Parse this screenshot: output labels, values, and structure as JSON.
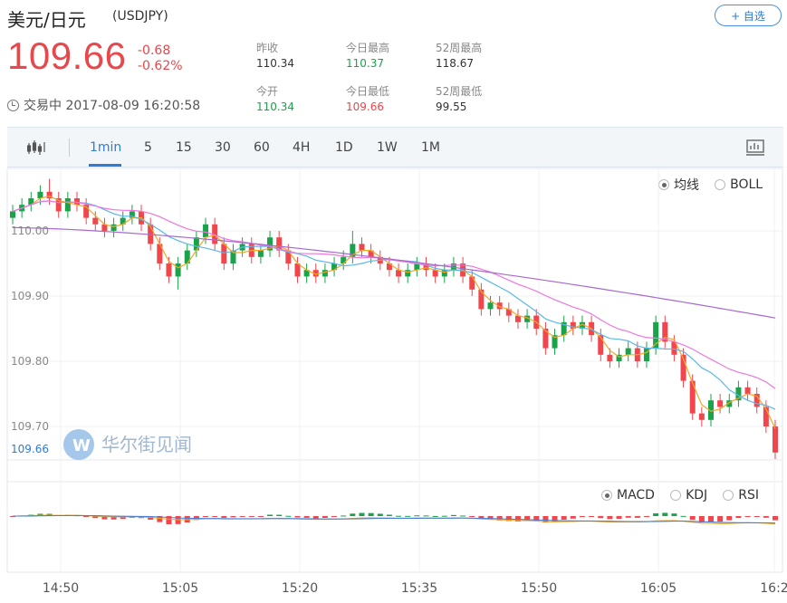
{
  "header": {
    "title": "美元/日元",
    "code": "(USDJPY)",
    "add_label": "+ 自选",
    "price": "109.66",
    "change": "-0.68",
    "change_pct": "-0.62%",
    "status": "交易中 2017-08-09 16:20:58"
  },
  "stats": {
    "prev_close_label": "昨收",
    "prev_close": "110.34",
    "open_label": "今开",
    "open": "110.34",
    "high_label": "今日最高",
    "high": "110.37",
    "low_label": "今日最低",
    "low": "109.66",
    "w52_high_label": "52周最高",
    "w52_high": "118.67",
    "w52_low_label": "52周最低",
    "w52_low": "99.55"
  },
  "toolbar": {
    "tabs": [
      "1min",
      "5",
      "15",
      "30",
      "60",
      "4H",
      "1D",
      "1W",
      "1M"
    ],
    "active": "1min"
  },
  "indicators": {
    "main": [
      "均线",
      "BOLL"
    ],
    "main_selected": "均线",
    "sub": [
      "MACD",
      "KDJ",
      "RSI"
    ],
    "sub_selected": "MACD"
  },
  "watermark": "华尔街见闻",
  "colors": {
    "up": "#1aa34a",
    "down": "#f0464c",
    "accent": "#2f7bd8",
    "ma_orange": "#f5a623",
    "ma_blue": "#5bb8e8",
    "ma_pink": "#ee77dd",
    "ma_purple": "#a66ad0"
  },
  "chart_data": {
    "type": "candlestick",
    "y_ticks": [
      "110.00",
      "109.90",
      "109.80",
      "109.70"
    ],
    "y_last": "109.66",
    "x_ticks": [
      "14:50",
      "15:05",
      "15:20",
      "15:35",
      "15:50",
      "16:05",
      "16:2"
    ],
    "ylim": [
      109.66,
      110.37
    ],
    "candles": [
      [
        110.02,
        110.03,
        110.04,
        110.01
      ],
      [
        110.03,
        110.04,
        110.05,
        110.02
      ],
      [
        110.04,
        110.05,
        110.06,
        110.03
      ],
      [
        110.05,
        110.06,
        110.07,
        110.04
      ],
      [
        110.06,
        110.05,
        110.08,
        110.04
      ],
      [
        110.05,
        110.03,
        110.06,
        110.02
      ],
      [
        110.03,
        110.05,
        110.06,
        110.02
      ],
      [
        110.05,
        110.04,
        110.06,
        110.03
      ],
      [
        110.04,
        110.02,
        110.05,
        110.01
      ],
      [
        110.02,
        110.01,
        110.03,
        110.0
      ],
      [
        110.01,
        110.0,
        110.02,
        109.99
      ],
      [
        110.0,
        110.01,
        110.02,
        109.99
      ],
      [
        110.01,
        110.02,
        110.03,
        110.0
      ],
      [
        110.02,
        110.03,
        110.04,
        110.01
      ],
      [
        110.03,
        110.01,
        110.04,
        110.0
      ],
      [
        110.01,
        109.98,
        110.02,
        109.97
      ],
      [
        109.98,
        109.95,
        109.99,
        109.94
      ],
      [
        109.95,
        109.93,
        109.96,
        109.92
      ],
      [
        109.93,
        109.95,
        109.96,
        109.91
      ],
      [
        109.95,
        109.97,
        109.98,
        109.94
      ],
      [
        109.97,
        109.99,
        110.0,
        109.96
      ],
      [
        109.99,
        110.01,
        110.02,
        109.98
      ],
      [
        110.01,
        109.98,
        110.02,
        109.97
      ],
      [
        109.98,
        109.95,
        109.99,
        109.94
      ],
      [
        109.95,
        109.97,
        109.98,
        109.94
      ],
      [
        109.97,
        109.98,
        109.99,
        109.96
      ],
      [
        109.98,
        109.96,
        109.99,
        109.95
      ],
      [
        109.96,
        109.97,
        109.98,
        109.95
      ],
      [
        109.97,
        109.99,
        110.0,
        109.96
      ],
      [
        109.99,
        109.97,
        110.0,
        109.96
      ],
      [
        109.97,
        109.95,
        109.98,
        109.94
      ],
      [
        109.95,
        109.93,
        109.96,
        109.92
      ],
      [
        109.93,
        109.94,
        109.95,
        109.92
      ],
      [
        109.94,
        109.93,
        109.95,
        109.92
      ],
      [
        109.93,
        109.94,
        109.95,
        109.92
      ],
      [
        109.94,
        109.95,
        109.96,
        109.93
      ],
      [
        109.95,
        109.96,
        109.97,
        109.94
      ],
      [
        109.96,
        109.98,
        110.0,
        109.95
      ],
      [
        109.98,
        109.97,
        109.99,
        109.96
      ],
      [
        109.97,
        109.96,
        109.98,
        109.95
      ],
      [
        109.96,
        109.95,
        109.97,
        109.94
      ],
      [
        109.95,
        109.94,
        109.96,
        109.93
      ],
      [
        109.94,
        109.93,
        109.95,
        109.92
      ],
      [
        109.93,
        109.94,
        109.95,
        109.92
      ],
      [
        109.94,
        109.95,
        109.96,
        109.93
      ],
      [
        109.95,
        109.94,
        109.96,
        109.93
      ],
      [
        109.94,
        109.93,
        109.95,
        109.92
      ],
      [
        109.93,
        109.94,
        109.95,
        109.92
      ],
      [
        109.94,
        109.95,
        109.96,
        109.93
      ],
      [
        109.95,
        109.93,
        109.96,
        109.92
      ],
      [
        109.93,
        109.91,
        109.94,
        109.9
      ],
      [
        109.91,
        109.88,
        109.92,
        109.87
      ],
      [
        109.88,
        109.89,
        109.9,
        109.87
      ],
      [
        109.89,
        109.88,
        109.9,
        109.87
      ],
      [
        109.88,
        109.87,
        109.89,
        109.86
      ],
      [
        109.87,
        109.86,
        109.88,
        109.85
      ],
      [
        109.86,
        109.87,
        109.88,
        109.85
      ],
      [
        109.87,
        109.85,
        109.88,
        109.84
      ],
      [
        109.85,
        109.82,
        109.86,
        109.81
      ],
      [
        109.82,
        109.84,
        109.85,
        109.81
      ],
      [
        109.84,
        109.86,
        109.87,
        109.83
      ],
      [
        109.86,
        109.85,
        109.87,
        109.84
      ],
      [
        109.85,
        109.86,
        109.87,
        109.84
      ],
      [
        109.86,
        109.84,
        109.87,
        109.83
      ],
      [
        109.84,
        109.81,
        109.85,
        109.8
      ],
      [
        109.81,
        109.8,
        109.82,
        109.79
      ],
      [
        109.8,
        109.81,
        109.82,
        109.79
      ],
      [
        109.81,
        109.82,
        109.83,
        109.8
      ],
      [
        109.82,
        109.8,
        109.83,
        109.79
      ],
      [
        109.8,
        109.82,
        109.83,
        109.79
      ],
      [
        109.82,
        109.86,
        109.87,
        109.81
      ],
      [
        109.86,
        109.83,
        109.87,
        109.82
      ],
      [
        109.83,
        109.81,
        109.84,
        109.8
      ],
      [
        109.81,
        109.77,
        109.82,
        109.76
      ],
      [
        109.77,
        109.72,
        109.78,
        109.71
      ],
      [
        109.72,
        109.71,
        109.73,
        109.7
      ],
      [
        109.71,
        109.74,
        109.75,
        109.7
      ],
      [
        109.74,
        109.73,
        109.75,
        109.72
      ],
      [
        109.73,
        109.74,
        109.75,
        109.72
      ],
      [
        109.74,
        109.76,
        109.77,
        109.73
      ],
      [
        109.76,
        109.75,
        109.77,
        109.74
      ],
      [
        109.75,
        109.73,
        109.76,
        109.72
      ],
      [
        109.73,
        109.7,
        109.74,
        109.69
      ],
      [
        109.7,
        109.66,
        109.71,
        109.65
      ]
    ]
  }
}
